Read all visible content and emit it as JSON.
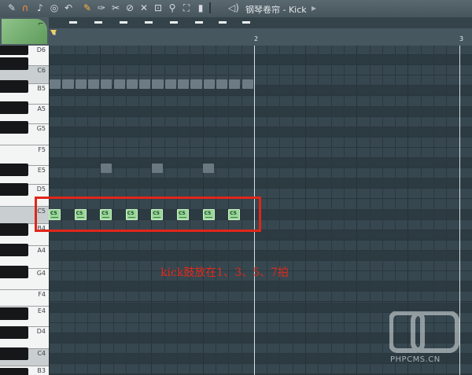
{
  "toolbar": {
    "title": "钢琴卷帘 - Kick",
    "icons": [
      "wrench-icon",
      "magnet-icon",
      "note-icon",
      "target-icon",
      "undo-icon",
      "pencil-icon",
      "brush-icon",
      "slice-icon",
      "delete-icon",
      "mute-icon",
      "select-icon",
      "zoom-icon",
      "fullscreen-icon",
      "volume-icon",
      "speaker-icon"
    ]
  },
  "timeline": {
    "bars": [
      "2",
      "3"
    ]
  },
  "piano": {
    "keys": [
      "D6",
      "C6",
      "B5",
      "A5",
      "G5",
      "F5",
      "E5",
      "D5",
      "C5",
      "B4",
      "A4",
      "G4",
      "F4",
      "E4",
      "D4",
      "C4",
      "B3"
    ]
  },
  "notes": {
    "label": "C5",
    "count": 8
  },
  "annotation": "kick鼓放在1、3、5、7拍",
  "watermark": "PHPCMS.CN",
  "colors": {
    "note_fill": "#9ad79a",
    "highlight": "#e0261a",
    "annotation_text": "#e02a1c"
  }
}
